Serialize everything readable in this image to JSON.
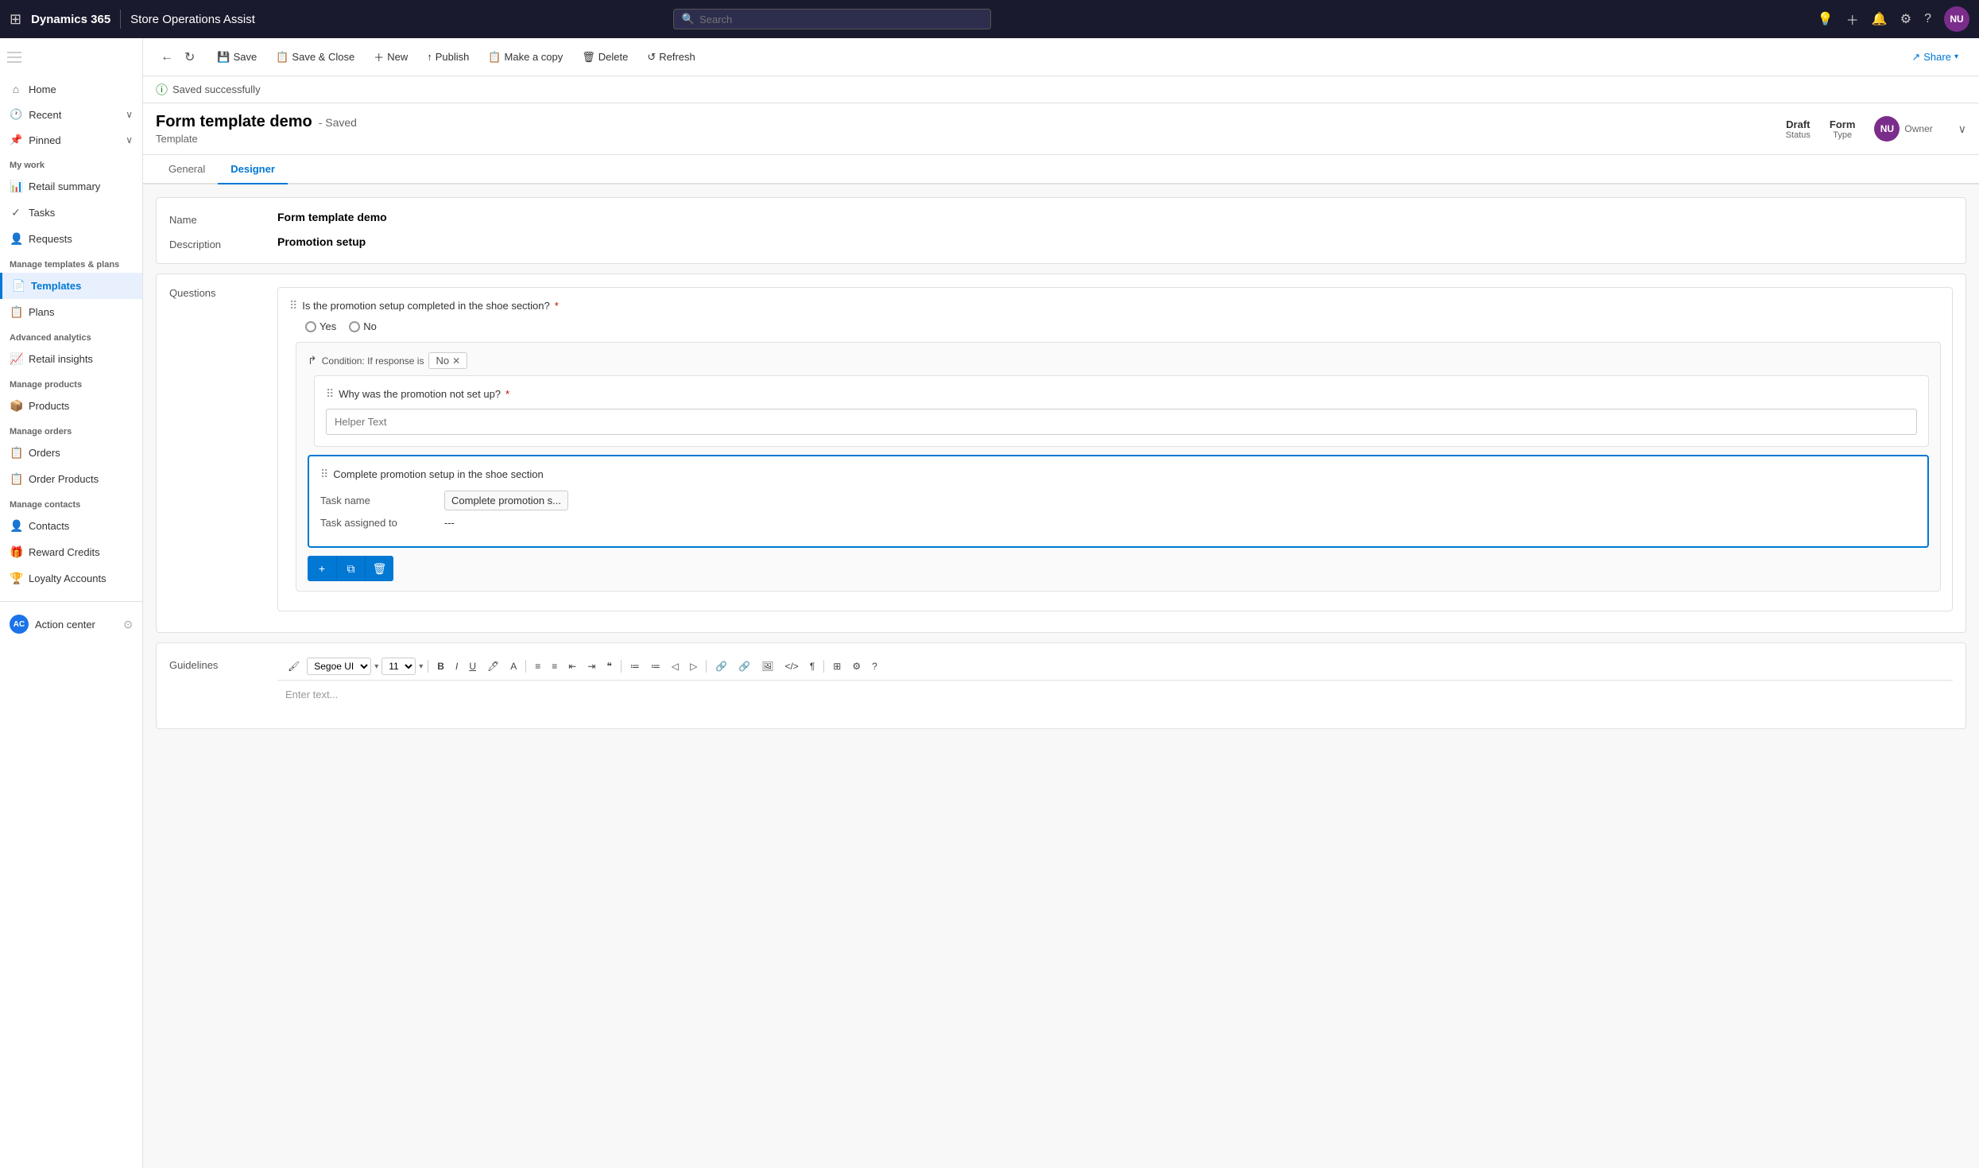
{
  "topbar": {
    "brand": "Dynamics 365",
    "app": "Store Operations Assist",
    "search_placeholder": "Search",
    "avatar": "NU"
  },
  "commands": {
    "back": "←",
    "forward": "↻",
    "save": "Save",
    "save_close": "Save & Close",
    "new": "New",
    "publish": "Publish",
    "make_copy": "Make a copy",
    "delete": "Delete",
    "refresh": "Refresh",
    "share": "Share"
  },
  "status_bar": {
    "message": "Saved successfully"
  },
  "form_header": {
    "title": "Form template demo",
    "saved_status": "- Saved",
    "subtitle": "Template",
    "status_label": "Status",
    "status_value": "Draft",
    "type_label": "Type",
    "type_value": "Form",
    "owner_label": "Owner",
    "avatar": "NU"
  },
  "tabs": [
    {
      "id": "general",
      "label": "General"
    },
    {
      "id": "designer",
      "label": "Designer"
    }
  ],
  "active_tab": "designer",
  "form": {
    "name_label": "Name",
    "name_value": "Form template demo",
    "description_label": "Description",
    "description_value": "Promotion setup",
    "questions_label": "Questions",
    "question1": {
      "text": "Is the promotion setup completed in the shoe section?",
      "required": true,
      "type": "yesno",
      "yes_label": "Yes",
      "no_label": "No"
    },
    "condition": {
      "label": "Condition: If response is",
      "value": "No"
    },
    "question2": {
      "text": "Why was the promotion not set up?",
      "required": true,
      "placeholder": "Helper Text"
    },
    "task": {
      "title": "Complete promotion setup in the shoe section",
      "name_label": "Task name",
      "name_value": "Complete promotion s...",
      "assigned_label": "Task assigned to",
      "assigned_value": "---"
    },
    "action_btns": {
      "add": "+",
      "copy": "⧉",
      "delete": "🗑"
    },
    "guidelines_label": "Guidelines",
    "guidelines_placeholder": "Enter text...",
    "font_name": "Segoe UI",
    "font_size": "11"
  },
  "sidebar": {
    "hamburger": "≡",
    "sections": [
      {
        "label": "",
        "items": [
          {
            "id": "home",
            "label": "Home",
            "icon": "⌂"
          },
          {
            "id": "recent",
            "label": "Recent",
            "icon": "🕐",
            "expand": true
          },
          {
            "id": "pinned",
            "label": "Pinned",
            "icon": "📌",
            "expand": true
          }
        ]
      },
      {
        "label": "My work",
        "items": [
          {
            "id": "retail-summary",
            "label": "Retail summary",
            "icon": "📊"
          },
          {
            "id": "tasks",
            "label": "Tasks",
            "icon": "✓"
          },
          {
            "id": "requests",
            "label": "Requests",
            "icon": "👤"
          }
        ]
      },
      {
        "label": "Manage templates & plans",
        "items": [
          {
            "id": "templates",
            "label": "Templates",
            "icon": "📄",
            "active": true
          },
          {
            "id": "plans",
            "label": "Plans",
            "icon": "📋"
          }
        ]
      },
      {
        "label": "Advanced analytics",
        "items": [
          {
            "id": "retail-insights",
            "label": "Retail insights",
            "icon": "📈"
          }
        ]
      },
      {
        "label": "Manage products",
        "items": [
          {
            "id": "products",
            "label": "Products",
            "icon": "📦"
          }
        ]
      },
      {
        "label": "Manage orders",
        "items": [
          {
            "id": "orders",
            "label": "Orders",
            "icon": "📋"
          },
          {
            "id": "order-products",
            "label": "Order Products",
            "icon": "📋"
          }
        ]
      },
      {
        "label": "Manage contacts",
        "items": [
          {
            "id": "contacts",
            "label": "Contacts",
            "icon": "👤"
          },
          {
            "id": "reward-credits",
            "label": "Reward Credits",
            "icon": "🎁"
          },
          {
            "id": "loyalty-accounts",
            "label": "Loyalty Accounts",
            "icon": "🏆"
          }
        ]
      }
    ],
    "bottom": {
      "ac_label": "AC",
      "action_center": "Action center",
      "pin_icon": "⊙"
    }
  }
}
